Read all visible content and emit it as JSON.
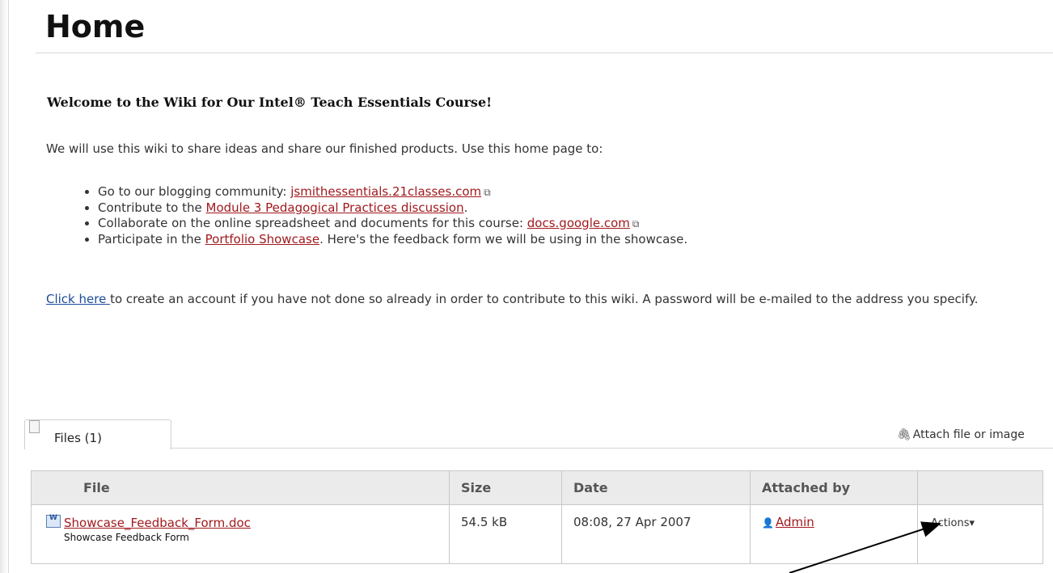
{
  "page": {
    "title": "Home",
    "welcome_heading": "Welcome to the Wiki for Our Intel® Teach Essentials Course!",
    "intro": "We will use this wiki to share ideas and share our finished products. Use this home page to:"
  },
  "links": {
    "item1": {
      "prefix": "Go to our blogging community: ",
      "link": "jsmithessentials.21classes.com",
      "icon": "external-link-icon"
    },
    "item2": {
      "prefix": "Contribute to the ",
      "link": "Module 3 Pedagogical Practices discussion",
      "suffix": "."
    },
    "item3": {
      "prefix": "Collaborate on the online spreadsheet and documents for this course: ",
      "link": "docs.google.com",
      "icon": "external-link-icon"
    },
    "item4": {
      "prefix": "Participate in the ",
      "link": "Portfolio Showcase",
      "suffix": ". Here's the feedback form we will be using in the showcase."
    }
  },
  "account": {
    "link": "Click here ",
    "text": "to create an account if you have not done so already in order to contribute to this wiki. A password will be e-mailed to the address you specify."
  },
  "files_panel": {
    "tab_label": "Files (1)",
    "tab_icon": "page-icon",
    "attach_label": "Attach file or image",
    "attach_icon": "paperclip-icon",
    "columns": [
      "File",
      "Size",
      "Date",
      "Attached by",
      ""
    ],
    "rows": [
      {
        "file_name": "Showcase_Feedback_Form.doc",
        "file_description": "Showcase Feedback Form",
        "file_icon": "word-document-icon",
        "size": "54.5 kB",
        "date": "08:08, 27 Apr 2007",
        "attached_by": "Admin",
        "user_icon": "user-icon",
        "actions": "Actions"
      }
    ]
  }
}
